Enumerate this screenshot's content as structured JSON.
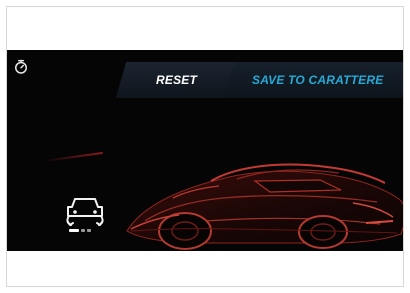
{
  "controls": {
    "reset_label": "RESET",
    "save_label": "SAVE TO CARATTERE"
  },
  "icons": {
    "timer": "stopwatch-icon",
    "drive_mode": "car-mode-icon",
    "vehicle": "sports-car-wireframe"
  },
  "colors": {
    "background": "#050506",
    "accent": "#27a9d6",
    "reset_text": "#ffffff",
    "car_highlight": "#d23d33"
  }
}
